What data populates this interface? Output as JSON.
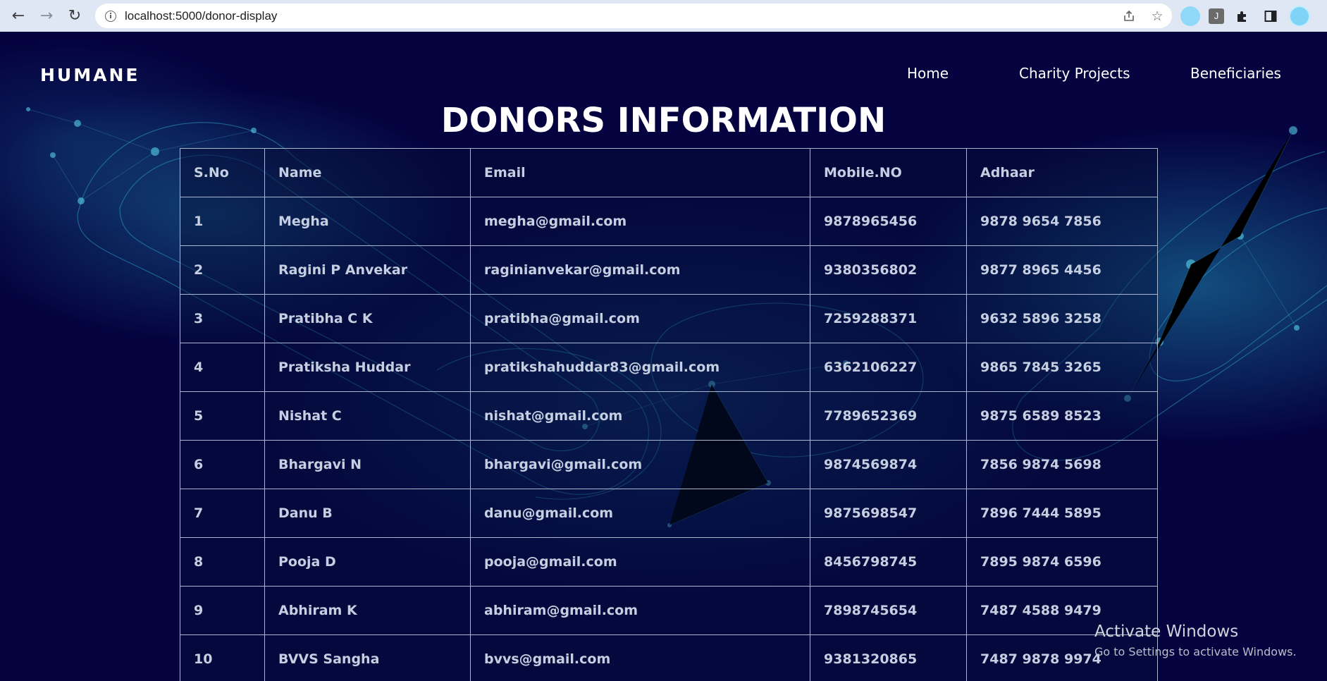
{
  "browser": {
    "url": "localhost:5000/donor-display",
    "icons": [
      "back-arrow-icon",
      "forward-arrow-icon",
      "reload-icon",
      "info-icon",
      "share-icon",
      "star-icon",
      "extension-icon",
      "puzzle-icon",
      "sidebar-icon",
      "profile-avatar"
    ],
    "extension_j_label": "J"
  },
  "nav": {
    "brand": "HUMANE",
    "links": [
      "Home",
      "Charity Projects",
      "Beneficiaries"
    ]
  },
  "page": {
    "title": "DONORS INFORMATION"
  },
  "table": {
    "headers": [
      "S.No",
      "Name",
      "Email",
      "Mobile.NO",
      "Adhaar"
    ],
    "rows": [
      [
        "1",
        "Megha",
        "megha@gmail.com",
        "9878965456",
        "9878 9654 7856"
      ],
      [
        "2",
        "Ragini P Anvekar",
        "raginianvekar@gmail.com",
        "9380356802",
        "9877 8965 4456"
      ],
      [
        "3",
        "Pratibha C K",
        "pratibha@gmail.com",
        "7259288371",
        "9632 5896 3258"
      ],
      [
        "4",
        "Pratiksha Huddar",
        "pratikshahuddar83@gmail.com",
        "6362106227",
        "9865 7845 3265"
      ],
      [
        "5",
        "Nishat C",
        "nishat@gmail.com",
        "7789652369",
        "9875 6589 8523"
      ],
      [
        "6",
        "Bhargavi N",
        "bhargavi@gmail.com",
        "9874569874",
        "7856 9874 5698"
      ],
      [
        "7",
        "Danu B",
        "danu@gmail.com",
        "9875698547",
        "7896 7444 5895"
      ],
      [
        "8",
        "Pooja D",
        "pooja@gmail.com",
        "8456798745",
        "7895 9874 6596"
      ],
      [
        "9",
        "Abhiram K",
        "abhiram@gmail.com",
        "7898745654",
        "7487 4588 9479"
      ],
      [
        "10",
        "BVVS Sangha",
        "bvvs@gmail.com",
        "9381320865",
        "7487 9878 9974"
      ]
    ]
  },
  "watermark": {
    "title": "Activate Windows",
    "subtitle": "Go to Settings to activate Windows."
  },
  "colors": {
    "page_bg": "#04023f",
    "chrome_bg": "#dfe7f5",
    "table_text": "#c6cfe1",
    "table_border": "#a8b6cf",
    "accent_cyan": "#2fb8d6"
  }
}
